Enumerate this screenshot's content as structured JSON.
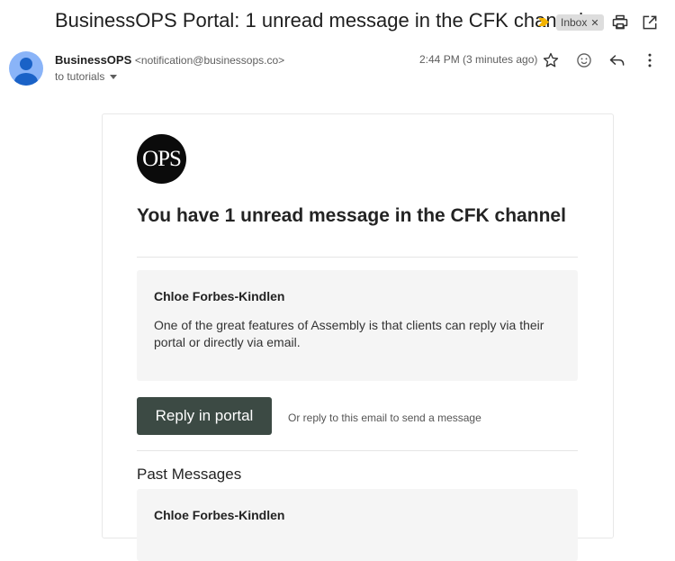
{
  "email": {
    "subject": "BusinessOPS Portal: 1 unread message in the CFK channel",
    "label": "Inbox",
    "sender_name": "BusinessOPS",
    "sender_email": "<notification@businessops.co>",
    "recipient": "to tutorials",
    "time": "2:44 PM (3 minutes ago)"
  },
  "icons": {
    "importance": "importance-marker-icon",
    "print": "print-icon",
    "open_new_window": "open-in-new-window-icon",
    "star": "star-icon",
    "emoji": "emoji-reaction-icon",
    "reply": "reply-icon",
    "more": "more-vert-icon"
  },
  "colors": {
    "importance": "#f4b400",
    "button": "#3c4a44",
    "avatar": "#8ab4f8"
  },
  "body": {
    "logo_text": "OPS",
    "headline": "You have 1 unread message in the CFK channel",
    "message": {
      "author": "Chloe Forbes-Kindlen",
      "text": "One of the great features of Assembly is that clients can reply via their portal or directly via email."
    },
    "reply_button": "Reply in portal",
    "reply_alt": "Or reply to this email to send a message",
    "past_title": "Past Messages",
    "past_messages": [
      {
        "author": "Chloe Forbes-Kindlen"
      }
    ]
  }
}
